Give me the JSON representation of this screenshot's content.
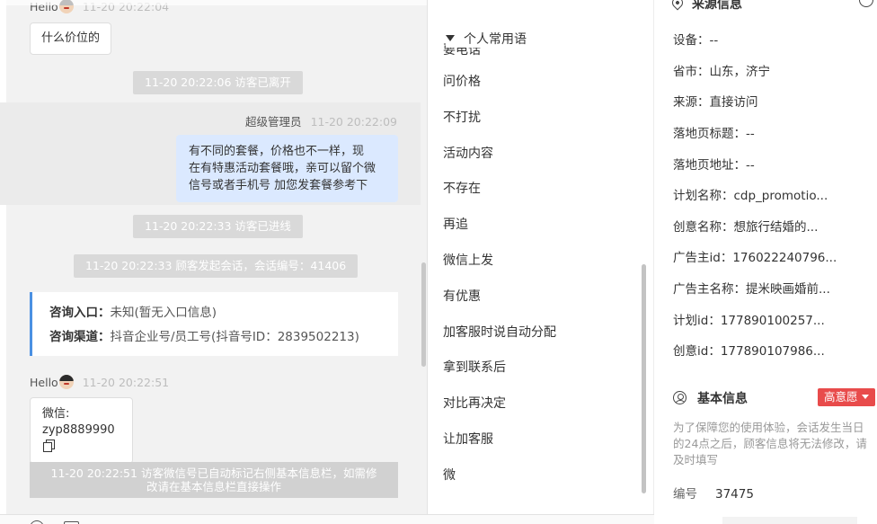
{
  "chat": {
    "top_meta": {
      "name": "Hello",
      "time": "11-20 20:22:04"
    },
    "msg_price": "什么价位的",
    "sys_left": "11-20 20:22:06 访客已离开",
    "admin_meta": {
      "name": "超级管理员",
      "time": "11-20 20:22:09"
    },
    "reply_lines": [
      "有不同的套餐，价格也不一样，现",
      "在有特惠活动套餐哦，亲可以留个微",
      "信号或者手机号 加您发套餐参考下"
    ],
    "sys_enter": "11-20 20:22:33 访客已进线",
    "sys_session": "11-20 20:22:33 顾客发起会话，会话编号：41406",
    "entry": {
      "label1": "咨询入口：",
      "value1": "未知(暂无入口信息)",
      "label2": "咨询渠道：",
      "value2": "抖音企业号/员工号(抖音号ID：2839502213)"
    },
    "hello_meta": {
      "name": "Hello",
      "time": "11-20 20:22:51"
    },
    "wechat_label": "微信:",
    "wechat_value": "zyp8889990",
    "sys_auto_lines": [
      "11-20 20:22:51 访客微信号已自动标记右侧基本信息栏，如需修",
      "改请在基本信息栏直接操作"
    ]
  },
  "phrases": {
    "header": "个人常用语",
    "partial_item": "要电话",
    "items": [
      "问价格",
      "不打扰",
      "活动内容",
      "不存在",
      "再追",
      "微信上发",
      "有优惠",
      "加客服时说自动分配",
      "拿到联系后",
      "对比再决定",
      "让加客服",
      "微"
    ]
  },
  "info": {
    "source_title": "来源信息",
    "source_rows": [
      "设备：--",
      "省市：山东，济宁",
      "来源：直接访问",
      "落地页标题：--",
      "落地页地址：--",
      "计划名称：cdp_promotio...",
      "创意名称：想旅行结婚的...",
      "广告主id：176022240796...",
      "广告主名称：提米映画婚前...",
      "计划id：177890100257...",
      "创意id：177890107986..."
    ],
    "basic_title": "基本信息",
    "intent_badge": "高意愿",
    "notice": "为了保障您的使用体验，会话发生当日的24点之后，顾客信息将无法修改，请及时填写",
    "id_label": "编号",
    "id_value": "37475"
  },
  "colors": {
    "accent_blue": "#4a90e2",
    "reply_bubble": "#dbe9ff",
    "intent_red": "#e84b4b",
    "system_pill": "#d9d9d9"
  }
}
